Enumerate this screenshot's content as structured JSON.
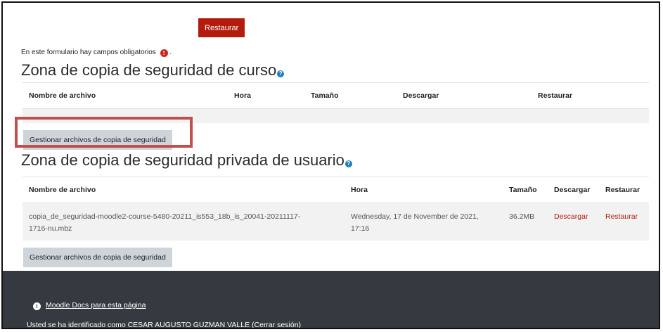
{
  "restore_button": "Restaurar",
  "required_note": "En este formulario hay campos obligatorios",
  "required_icon": "!",
  "required_suffix": ".",
  "course_zone": {
    "title": "Zona de copia de seguridad de curso",
    "headers": [
      "Nombre de archivo",
      "Hora",
      "Tamaño",
      "Descargar",
      "Restaurar"
    ],
    "manage_button": "Gestionar archivos de copia de seguridad"
  },
  "user_zone": {
    "title": "Zona de copia de seguridad privada de usuario",
    "headers": [
      "Nombre de archivo",
      "Hora",
      "Tamaño",
      "Descargar",
      "Restaurar"
    ],
    "row": {
      "filename_line1": "copia_de_seguridad-moodle2-course-5480-20211_is553_18b_is_20041-20211117-",
      "filename_line2": "1716-nu.mbz",
      "time_line1": "Wednesday, 17 de November de 2021,",
      "time_line2": "17:16",
      "size": "36.2MB",
      "download": "Descargar",
      "restore": "Restaurar"
    },
    "manage_button": "Gestionar archivos de copia de seguridad"
  },
  "footer": {
    "docs_link": "Moodle Docs para esta página",
    "identified_prefix": "Usted se ha identificado como",
    "user_name": "CESAR AUGUSTO GUZMAN VALLE",
    "logout_open": "(",
    "logout_link": "Cerrar sesión",
    "logout_close": ")"
  },
  "colors": {
    "accent": "#b31b0d",
    "footer_bg": "#343a40",
    "highlight": "#c0504d",
    "help": "#1f7fb8"
  }
}
